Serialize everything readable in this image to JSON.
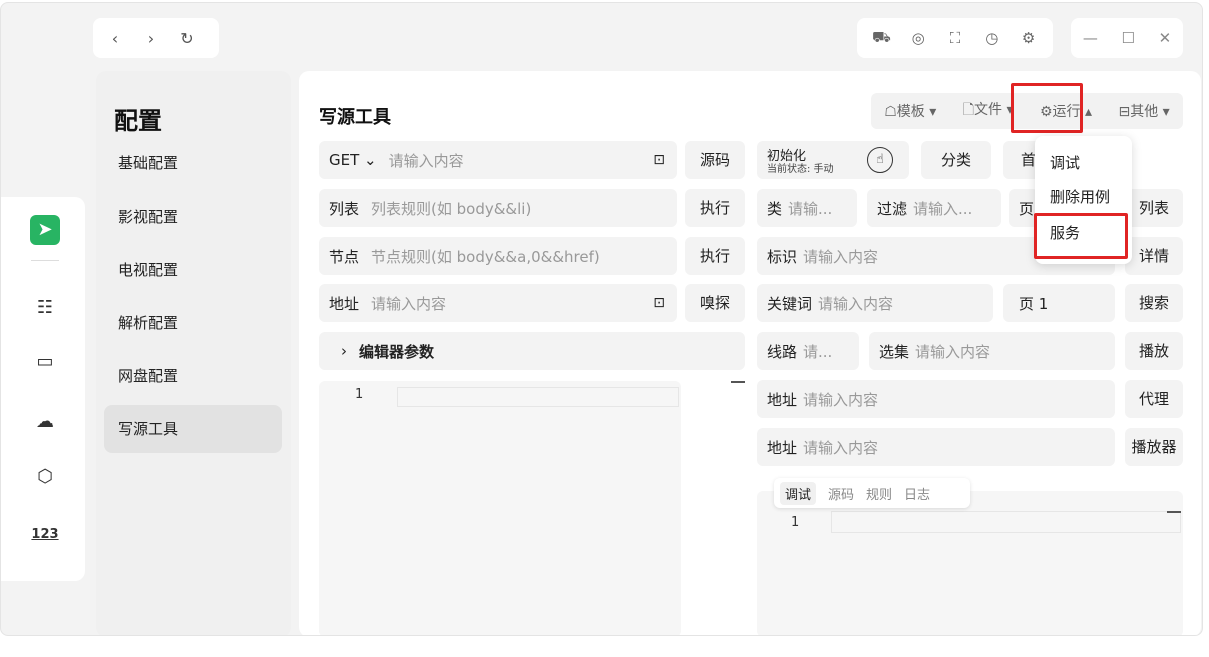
{
  "nav": {
    "back": "‹",
    "forward": "›",
    "refresh": "↻"
  },
  "tools": [
    "⛟",
    "◎",
    "⛶",
    "◷",
    "⚙"
  ],
  "window_controls": {
    "minimize": "—",
    "maximize": "☐",
    "close": "✕"
  },
  "rail": {
    "logo": "➤",
    "icons": [
      "☷",
      "▭",
      "☁",
      "⬡",
      "123"
    ]
  },
  "menu": {
    "title": "配置",
    "items": [
      "基础配置",
      "影视配置",
      "电视配置",
      "解析配置",
      "网盘配置",
      "写源工具"
    ]
  },
  "main": {
    "title": "写源工具",
    "toolbar": [
      "☖模板 ▾",
      "🗋文件 ▾",
      "⚙运行 ▴",
      "⊟其他 ▾"
    ],
    "left": {
      "method": "GET ⌄",
      "url_placeholder": "请输入内容",
      "source_btn": "源码",
      "list_label": "列表",
      "list_placeholder": "列表规则(如 body&&li)",
      "run1": "执行",
      "node_label": "节点",
      "node_placeholder": "节点规则(如 body&&a,0&&href)",
      "run2": "执行",
      "addr_label": "地址",
      "addr_placeholder": "请输入内容",
      "sniff_btn": "嗅探",
      "editor_params": "编辑器参数",
      "line1": "1"
    },
    "right": {
      "init_title": "初始化",
      "init_state": "当前状态: 手动",
      "classify_btn": "分类",
      "home_cut": "首",
      "cat_label": "类",
      "cat_placeholder": "请输...",
      "filter_label": "过滤",
      "filter_placeholder": "请输入...",
      "page_cut": "页",
      "list_btn": "列表",
      "id_label": "标识",
      "id_placeholder": "请输入内容",
      "detail_btn": "详情",
      "keyword_label": "关键词",
      "keyword_placeholder": "请输入内容",
      "page_label": "页 1",
      "search_btn": "搜索",
      "line_label": "线路",
      "line_placeholder": "请...",
      "episode_label": "选集",
      "episode_placeholder": "请输入内容",
      "play_btn": "播放",
      "addr1_label": "地址",
      "addr1_placeholder": "请输入内容",
      "proxy_btn": "代理",
      "addr2_label": "地址",
      "addr2_placeholder": "请输入内容",
      "player_btn": "播放器",
      "tabs": [
        "调试",
        "源码",
        "规则",
        "日志"
      ],
      "line1": "1"
    },
    "dropdown": [
      "调试",
      "删除用例",
      "服务"
    ]
  }
}
